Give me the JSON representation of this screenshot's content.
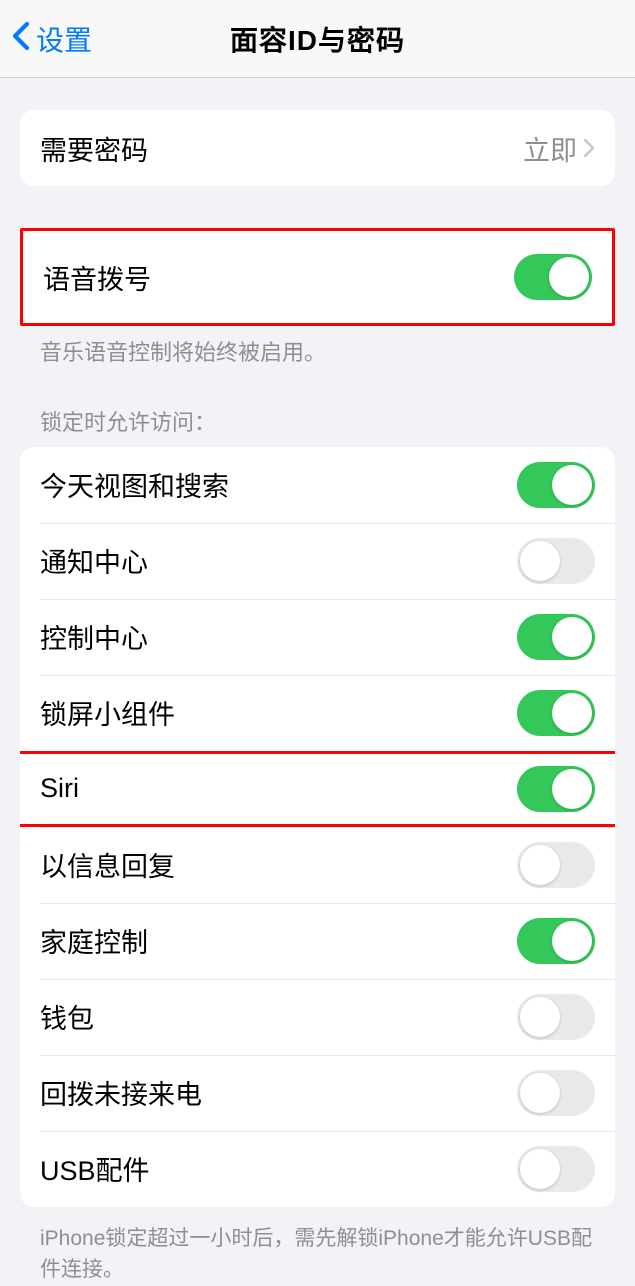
{
  "navbar": {
    "back_label": "设置",
    "title": "面容ID与密码"
  },
  "require_passcode": {
    "label": "需要密码",
    "value": "立即"
  },
  "voice_dial": {
    "label": "语音拨号",
    "footer": "音乐语音控制将始终被启用。"
  },
  "lock_access": {
    "header": "锁定时允许访问：",
    "items": [
      {
        "label": "今天视图和搜索",
        "on": true
      },
      {
        "label": "通知中心",
        "on": false
      },
      {
        "label": "控制中心",
        "on": true
      },
      {
        "label": "锁屏小组件",
        "on": true
      },
      {
        "label": "Siri",
        "on": true,
        "highlight": true
      },
      {
        "label": "以信息回复",
        "on": false
      },
      {
        "label": "家庭控制",
        "on": true
      },
      {
        "label": "钱包",
        "on": false
      },
      {
        "label": "回拨未接来电",
        "on": false
      },
      {
        "label": "USB配件",
        "on": false
      }
    ],
    "footer": "iPhone锁定超过一小时后，需先解锁iPhone才能允许USB配件连接。"
  }
}
